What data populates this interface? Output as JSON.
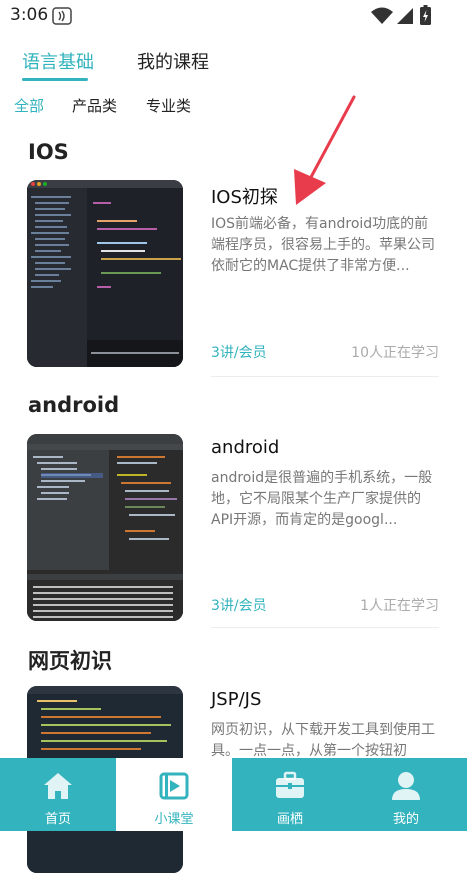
{
  "status": {
    "time": "3:06"
  },
  "top_tabs": [
    {
      "label": "语言基础",
      "active": true
    },
    {
      "label": "我的课程",
      "active": false
    }
  ],
  "sub_tabs": [
    {
      "label": "全部",
      "active": true
    },
    {
      "label": "产品类",
      "active": false
    },
    {
      "label": "专业类",
      "active": false
    }
  ],
  "sections": [
    {
      "title": "IOS",
      "course": {
        "title": "IOS初探",
        "desc": "IOS前端必备，有android功底的前端程序员，很容易上手的。苹果公司依耐它的MAC提供了非常方便...",
        "lessons": "3讲/会员",
        "learners": "10人正在学习"
      }
    },
    {
      "title": "android",
      "course": {
        "title": "android",
        "desc": "android是很普遍的手机系统，一般地，它不局限某个生产厂家提供的API开源，而肯定的是googl...",
        "lessons": "3讲/会员",
        "learners": "1人正在学习"
      }
    },
    {
      "title": "网页初识",
      "course": {
        "title": "JSP/JS",
        "desc": "网页初识，从下载开发工具到使用工具。一点一点，从第一个按钮初",
        "lessons": "",
        "learners": ""
      }
    }
  ],
  "bottom_nav": [
    {
      "label": "首页",
      "icon": "home-icon",
      "active": false
    },
    {
      "label": "小课堂",
      "icon": "video-class-icon",
      "active": true
    },
    {
      "label": "画栖",
      "icon": "briefcase-icon",
      "active": false
    },
    {
      "label": "我的",
      "icon": "user-icon",
      "active": false
    }
  ],
  "colors": {
    "accent": "#33b3bd",
    "text": "#222222",
    "muted": "#777777",
    "annotation": "#e83b4b"
  }
}
